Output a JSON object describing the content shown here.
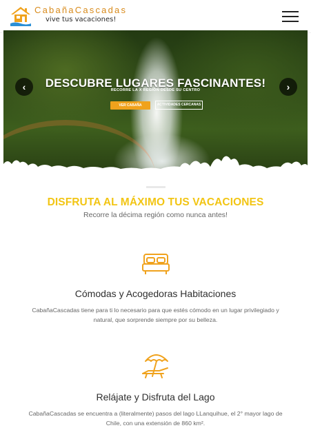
{
  "header": {
    "brand": "CabañaCascadas",
    "tagline": "vive tus vacaciones!"
  },
  "hero": {
    "title": "DESCUBRE LUGARES FASCINANTES!",
    "subtitle": "RECORRE LA X REGIÓN DESDE SU CENTRO",
    "primary_button": "VER CABAÑA",
    "secondary_button": "ACTIVIDADES CERCANAS",
    "prev_glyph": "‹",
    "next_glyph": "›"
  },
  "section": {
    "title": "DISFRUTA AL MÁXIMO TUS VACACIONES",
    "subtitle": "Recorre la décima región como nunca antes!"
  },
  "features": [
    {
      "icon": "bed-icon",
      "title": "Cómodas y Acogedoras Habitaciones",
      "text": "CabañaCascadas tiene para ti lo necesario para que estés cómodo en un lugar privilegiado y natural, que sorprende siempre por su belleza."
    },
    {
      "icon": "beach-umbrella-icon",
      "title": "Relájate y Disfruta del Lago",
      "text": "CabañaCascadas se encuentra a (literalmente) pasos del lago LLanquihue, el 2° mayor lago de Chile, con una extensión de 860 km²."
    }
  ],
  "colors": {
    "accent": "#f0a21c",
    "title_yellow": "#f2c514",
    "brand_orange": "#d88a1a"
  }
}
